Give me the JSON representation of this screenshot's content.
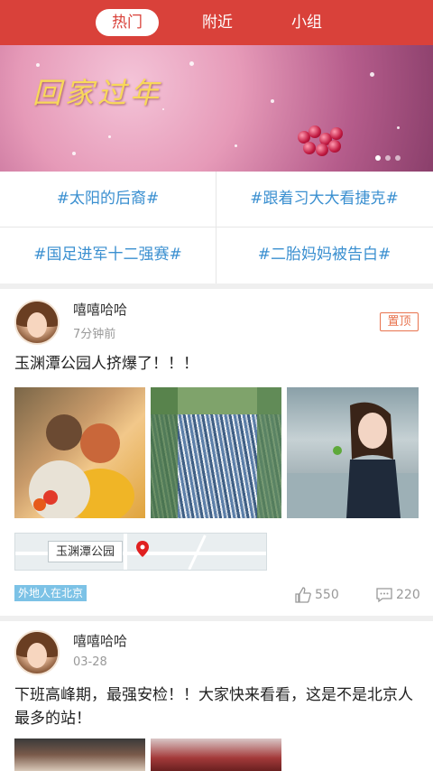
{
  "tabs": [
    "热门",
    "附近",
    "小组"
  ],
  "banner": {
    "title": "回家过年"
  },
  "topics": [
    "#太阳的后裔#",
    "#跟着习大大看捷克#",
    "#国足进军十二强赛#",
    "#二胎妈妈被告白#"
  ],
  "posts": [
    {
      "name": "嘻嘻哈哈",
      "time": "7分钟前",
      "pin": "置顶",
      "text": "玉渊潭公园人挤爆了！！！",
      "location": "玉渊潭公园",
      "tag": "外地人在北京",
      "likes": "550",
      "comments": "220"
    },
    {
      "name": "嘻嘻哈哈",
      "time": "03-28",
      "text": "下班高峰期，最强安检！！大家快来看看，这是不是北京人最多的站！"
    }
  ],
  "colors": {
    "primary": "#d9413a",
    "topic": "#3a8fd0",
    "pin": "#e8734e",
    "tag": "#7cc2e6"
  }
}
